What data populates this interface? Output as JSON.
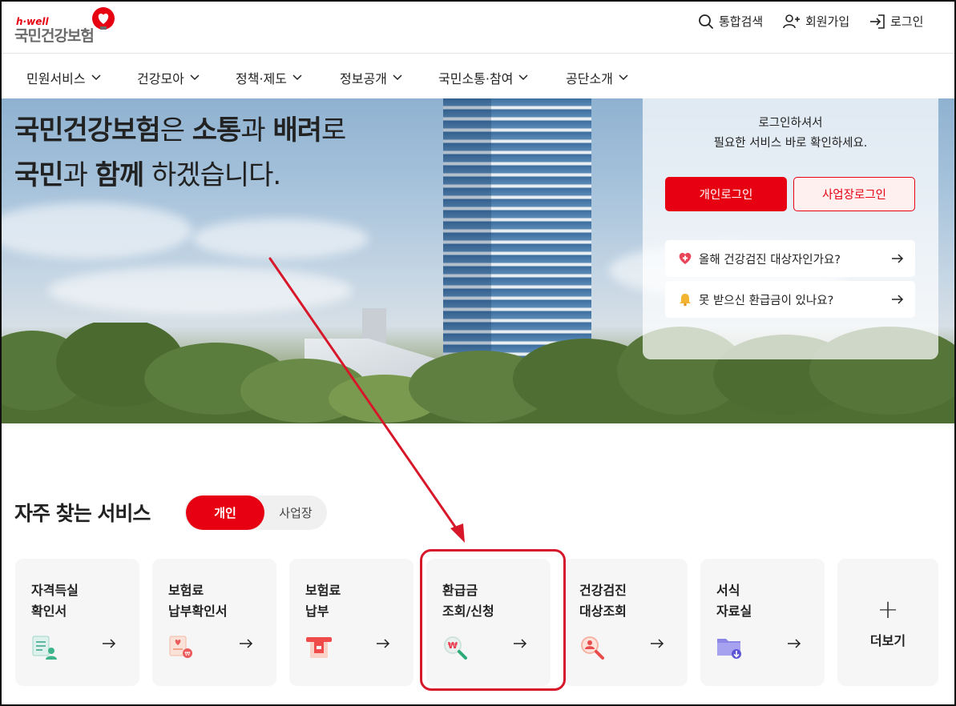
{
  "header": {
    "logo_small": "h·well",
    "logo_main": "국민건강보험",
    "search_label": "통합검색",
    "join_label": "회원가입",
    "login_label": "로그인"
  },
  "nav": {
    "items": [
      {
        "label": "민원서비스"
      },
      {
        "label": "건강모아"
      },
      {
        "label": "정책·제도"
      },
      {
        "label": "정보공개"
      },
      {
        "label": "국민소통·참여"
      },
      {
        "label": "공단소개"
      }
    ]
  },
  "hero": {
    "line1": {
      "b1": "국민건강보험",
      "t1": "은 ",
      "b2": "소통",
      "t2": "과 ",
      "b3": "배려",
      "t3": "로"
    },
    "line2": {
      "b1": "국민",
      "t1": "과 ",
      "b2": "함께",
      "t2": " 하겠습니다."
    }
  },
  "login_panel": {
    "msg_line1": "로그인하셔서",
    "msg_line2": "필요한 서비스 바로 확인하세요.",
    "personal_login": "개인로그인",
    "business_login": "사업장로그인",
    "quick1": "올해 건강검진 대상자인가요?",
    "quick2": "못 받으신 환급금이 있나요?"
  },
  "services": {
    "title": "자주 찾는 서비스",
    "tab_personal": "개인",
    "tab_business": "사업장",
    "cards": [
      {
        "label": "자격득실\n확인서"
      },
      {
        "label": "보험료\n납부확인서"
      },
      {
        "label": "보험료\n납부"
      },
      {
        "label": "환급금\n조회/신청"
      },
      {
        "label": "건강검진\n대상조회"
      },
      {
        "label": "서식\n자료실"
      }
    ],
    "more_label": "더보기"
  },
  "colors": {
    "brand_red": "#e60012",
    "annotation_red": "#d7182a"
  }
}
